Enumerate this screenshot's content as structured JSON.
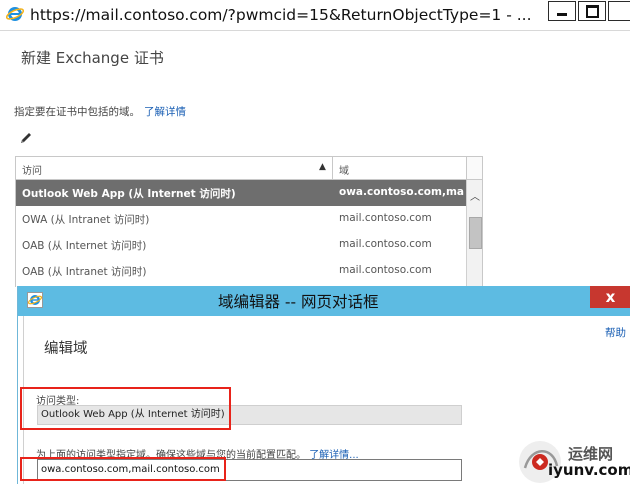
{
  "window": {
    "url": "https://mail.contoso.com/?pwmcid=15&ReturnObjectType=1 - ..."
  },
  "page": {
    "title": "新建 Exchange 证书",
    "instruction": "指定要在证书中包括的域。",
    "learn_more": "了解详情"
  },
  "grid": {
    "columns": [
      "访问",
      "域"
    ],
    "sort_indicator": "▲",
    "rows": [
      {
        "access": "Outlook Web App (从 Internet 访问时)",
        "domain": "owa.contoso.com,mail.c...",
        "selected": true
      },
      {
        "access": "OWA (从 Intranet 访问时)",
        "domain": "mail.contoso.com",
        "selected": false
      },
      {
        "access": "OAB (从 Internet 访问时)",
        "domain": "mail.contoso.com",
        "selected": false
      },
      {
        "access": "OAB (从 Intranet 访问时)",
        "domain": "mail.contoso.com",
        "selected": false
      }
    ]
  },
  "dialog": {
    "title": "域编辑器 -- 网页对话框",
    "close": "x",
    "help": "帮助",
    "heading": "编辑域",
    "access_type_label": "访问类型:",
    "access_type_value": "Outlook Web App (从 Internet 访问时)",
    "note": "为上面的访问类型指定域。确保这些域与您的当前配置匹配。",
    "note_link": "了解详情...",
    "domain_value": "owa.contoso.com,mail.contoso.com"
  },
  "watermark": {
    "line1": "运维网",
    "line2": "iyunv.com"
  },
  "colors": {
    "dialog_bar": "#5dbbe2",
    "close_red": "#c7372f",
    "selected_row": "#6e6e6e",
    "link": "#1a5fb4",
    "highlight": "#e8231a"
  }
}
